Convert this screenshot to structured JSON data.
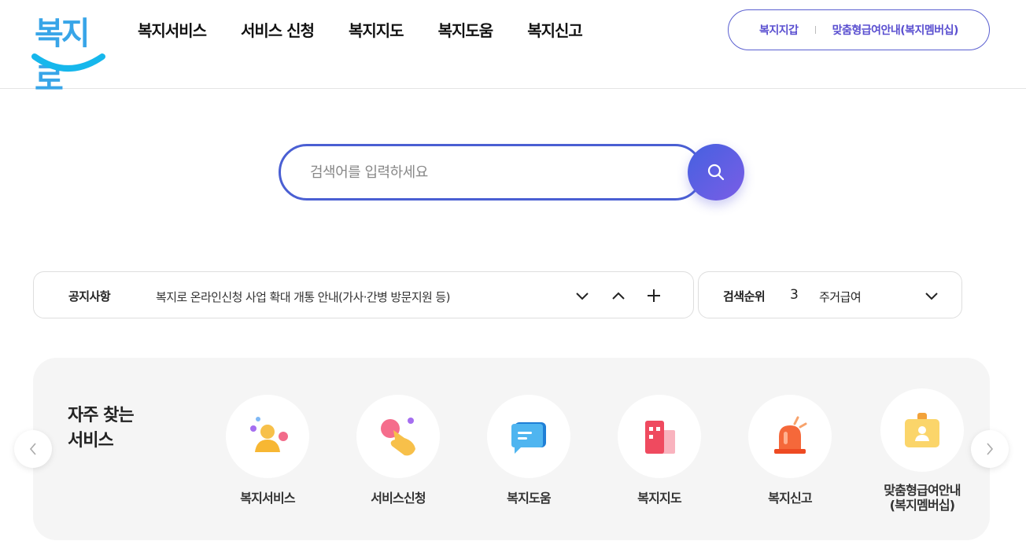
{
  "header": {
    "logo_text": "복지로",
    "nav": [
      "복지서비스",
      "서비스 신청",
      "복지지도",
      "복지도움",
      "복지신고"
    ],
    "util_links": [
      "복지지갑",
      "맞춤형급여안내(복지멤버십)"
    ]
  },
  "search": {
    "placeholder": "검색어를 입력하세요"
  },
  "notice": {
    "title": "공지사항",
    "text": "복지로 온라인신청 사업 확대 개통 안내(가사·간병 방문지원 등)"
  },
  "ranking": {
    "title": "검색순위",
    "number": "3",
    "keyword": "주거급여"
  },
  "quick": {
    "title_line1": "자주 찾는",
    "title_line2": "서비스",
    "items": [
      {
        "label": "복지서비스",
        "icon": "person-icon"
      },
      {
        "label": "서비스신청",
        "icon": "tap-hand-icon"
      },
      {
        "label": "복지도움",
        "icon": "chat-bubble-icon"
      },
      {
        "label": "복지지도",
        "icon": "building-icon"
      },
      {
        "label": "복지신고",
        "icon": "siren-icon"
      },
      {
        "label": "맞춤형급여안내",
        "label2": "(복지멤버십)",
        "icon": "id-card-icon"
      }
    ]
  },
  "colors": {
    "brand_blue": "#38a5e8",
    "accent_purple": "#5a4fd0",
    "search_border": "#4a5fd3",
    "quick_bg": "#f5f5f5"
  }
}
